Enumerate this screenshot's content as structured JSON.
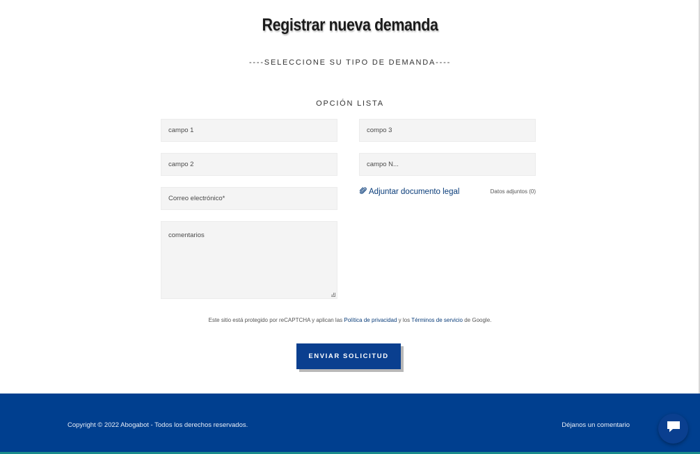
{
  "page": {
    "title": "Registrar nueva demanda",
    "type_heading": "----SELECCIONE SU TIPO DE DEMANDA----",
    "option_heading": "OPCIÓN LISTA"
  },
  "form": {
    "field1_placeholder": "campo 1",
    "field2_placeholder": "campo 2",
    "email_placeholder": "Correo electrónico*",
    "comments_placeholder": "comentarios",
    "field3_placeholder": "compo 3",
    "fieldN_placeholder": "campo N...",
    "attach_label": "Adjuntar documento legal",
    "attach_count": "Datos adjuntos (0)",
    "submit_label": "ENVIAR SOLICITUD"
  },
  "recaptcha": {
    "prefix": "Este sitio está protegido por reCAPTCHA y aplican las ",
    "privacy_link": "Política de privacidad",
    "middle": " y los ",
    "terms_link": "Términos de servicio",
    "suffix": " de Google."
  },
  "footer": {
    "copyright": "Copyright © 2022 Abogabot - Todos los derechos reservados.",
    "comment_link": "Déjanos un comentario"
  },
  "icons": {
    "attach": "paperclip-icon",
    "chat": "chat-bubble-icon"
  },
  "colors": {
    "accent": "#0a3f8f",
    "footer_bg": "#003f8f",
    "link": "#0a3d7a"
  }
}
